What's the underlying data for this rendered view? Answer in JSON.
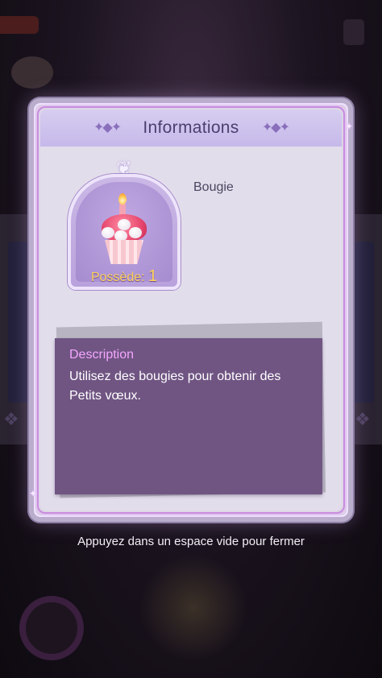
{
  "dialog": {
    "title": "Informations"
  },
  "item": {
    "name": "Bougie",
    "owned_label": "Possède:",
    "owned_count": "1"
  },
  "description": {
    "heading": "Description",
    "text": "Utilisez des bougies pour obtenir des Petits vœux."
  },
  "close_hint": "Appuyez dans un espace vide pour fermer",
  "colors": {
    "dialog_header": "#c6b9ea",
    "description_box": "#705583",
    "description_heading": "#f4a6ff",
    "owned_count": "#ffd35a"
  },
  "icons": {
    "item": "birthday-candle-cupcake-icon",
    "header_ornament": "sparkle-ornament-icon"
  }
}
